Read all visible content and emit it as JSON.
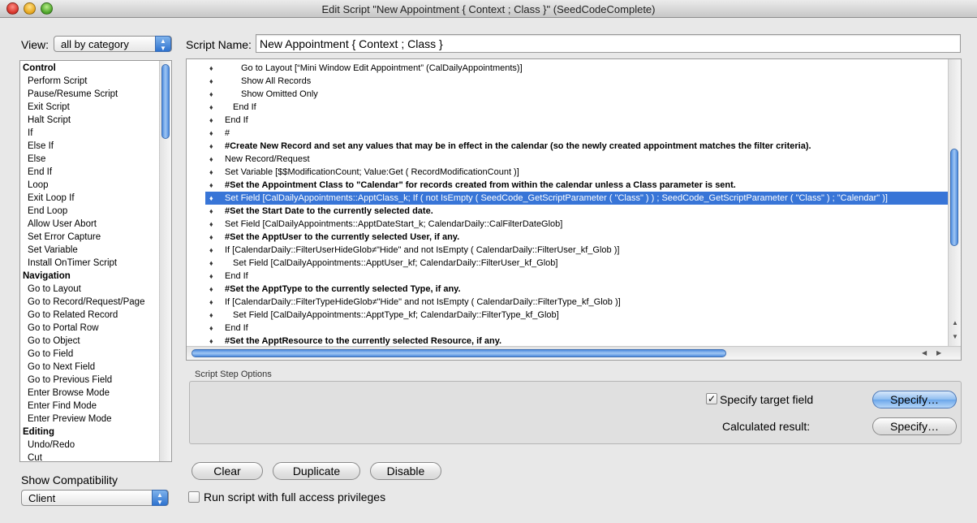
{
  "window": {
    "title": "Edit Script \"New Appointment { Context ; Class }\" (SeedCodeComplete)"
  },
  "view": {
    "label": "View:",
    "selected": "all by category"
  },
  "steps": [
    {
      "label": "Control",
      "category": true
    },
    {
      "label": "Perform Script"
    },
    {
      "label": "Pause/Resume Script"
    },
    {
      "label": "Exit Script"
    },
    {
      "label": "Halt Script"
    },
    {
      "label": "If"
    },
    {
      "label": "Else If"
    },
    {
      "label": "Else"
    },
    {
      "label": "End If"
    },
    {
      "label": "Loop"
    },
    {
      "label": "Exit Loop If"
    },
    {
      "label": "End Loop"
    },
    {
      "label": "Allow User Abort"
    },
    {
      "label": "Set Error Capture"
    },
    {
      "label": "Set Variable"
    },
    {
      "label": "Install OnTimer Script"
    },
    {
      "label": "Navigation",
      "category": true
    },
    {
      "label": "Go to Layout"
    },
    {
      "label": "Go to Record/Request/Page"
    },
    {
      "label": "Go to Related Record"
    },
    {
      "label": "Go to Portal Row"
    },
    {
      "label": "Go to Object"
    },
    {
      "label": "Go to Field"
    },
    {
      "label": "Go to Next Field"
    },
    {
      "label": "Go to Previous Field"
    },
    {
      "label": "Enter Browse Mode"
    },
    {
      "label": "Enter Find Mode"
    },
    {
      "label": "Enter Preview Mode"
    },
    {
      "label": "Editing",
      "category": true
    },
    {
      "label": "Undo/Redo"
    },
    {
      "label": "Cut"
    }
  ],
  "compatibility": {
    "label": "Show Compatibility",
    "selected": "Client"
  },
  "script_name": {
    "label": "Script Name:",
    "value": "New Appointment { Context ; Class }"
  },
  "script_lines": [
    {
      "indent": 2,
      "text": "Go to Layout [“Mini Window Edit Appointment” (CalDailyAppointments)]"
    },
    {
      "indent": 2,
      "text": "Show All Records"
    },
    {
      "indent": 2,
      "text": "Show Omitted Only"
    },
    {
      "indent": 1,
      "text": "End If"
    },
    {
      "indent": 0,
      "text": "End If"
    },
    {
      "indent": 0,
      "text": "#"
    },
    {
      "indent": 0,
      "text": "#Create New Record and set any values that may be in effect in the calendar (so the newly created appointment matches the filter criteria).",
      "bold": true
    },
    {
      "indent": 0,
      "text": "New Record/Request"
    },
    {
      "indent": 0,
      "text": "Set Variable [$$ModificationCount; Value:Get ( RecordModificationCount )]"
    },
    {
      "indent": 0,
      "text": "#Set the Appointment Class to \"Calendar\" for records created from within the calendar unless a Class parameter is sent.",
      "bold": true
    },
    {
      "indent": 0,
      "text": "Set Field [CalDailyAppointments::ApptClass_k; If ( not IsEmpty ( SeedCode_GetScriptParameter ( \"Class\" ) ) ; SeedCode_GetScriptParameter ( \"Class\" )  ; \"Calendar\" )]",
      "selected": true
    },
    {
      "indent": 0,
      "text": "#Set the Start Date to the currently selected date.",
      "bold": true
    },
    {
      "indent": 0,
      "text": "Set Field [CalDailyAppointments::ApptDateStart_k; CalendarDaily::CalFilterDateGlob]"
    },
    {
      "indent": 0,
      "text": "#Set the ApptUser to the currently selected User, if any.",
      "bold": true
    },
    {
      "indent": 0,
      "text": "If [CalendarDaily::FilterUserHideGlob≠\"Hide\" and not IsEmpty ( CalendarDaily::FilterUser_kf_Glob )]"
    },
    {
      "indent": 1,
      "text": "Set Field [CalDailyAppointments::ApptUser_kf; CalendarDaily::FilterUser_kf_Glob]"
    },
    {
      "indent": 0,
      "text": "End If"
    },
    {
      "indent": 0,
      "text": "#Set the ApptType to the currently selected Type, if any.",
      "bold": true
    },
    {
      "indent": 0,
      "text": "If [CalendarDaily::FilterTypeHideGlob≠\"Hide\" and not IsEmpty ( CalendarDaily::FilterType_kf_Glob )]"
    },
    {
      "indent": 1,
      "text": "Set Field [CalDailyAppointments::ApptType_kf; CalendarDaily::FilterType_kf_Glob]"
    },
    {
      "indent": 0,
      "text": "End If"
    },
    {
      "indent": 0,
      "text": "#Set the ApptResource to the currently selected Resource, if any.",
      "bold": true
    }
  ],
  "options": {
    "section_label": "Script Step Options",
    "specify_target_label": "Specify target field",
    "specify_target_checked": true,
    "specify_button_1": "Specify…",
    "calculated_label": "Calculated result:",
    "specify_button_2": "Specify…"
  },
  "buttons": {
    "clear": "Clear",
    "duplicate": "Duplicate",
    "disable": "Disable"
  },
  "privileges": {
    "label": "Run script with full access privileges",
    "checked": false
  },
  "colors": {
    "selection": "#3875d7",
    "accent_blue": "#4f8de0"
  }
}
